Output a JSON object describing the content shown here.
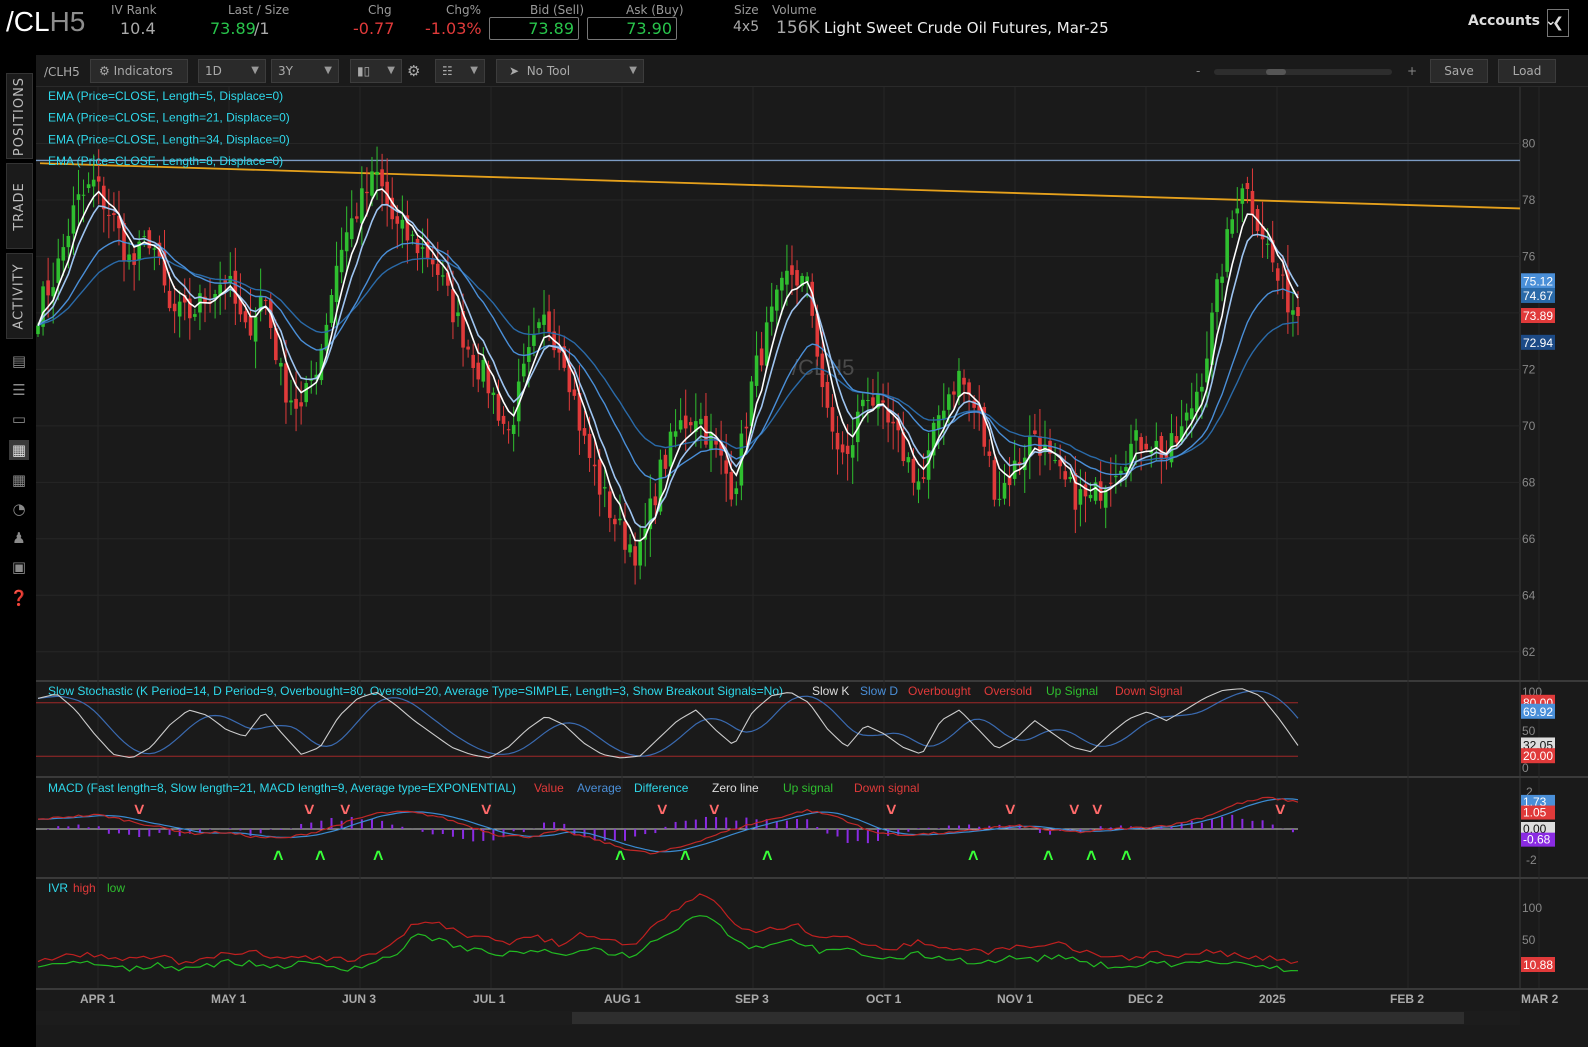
{
  "header": {
    "symbol_main": "/CL",
    "symbol_suffix": "H5",
    "iv_rank_label": "IV Rank",
    "iv_rank": "10.4",
    "last_size_label": "Last / Size",
    "last": "73.89",
    "size": "/1",
    "chg_label": "Chg",
    "chg": "-0.77",
    "chgpct_label": "Chg%",
    "chgpct": "-1.03%",
    "bid_label": "Bid (Sell)",
    "bid": "73.89",
    "ask_label": "Ask (Buy)",
    "ask": "73.90",
    "size_label": "Size",
    "size_val": "4x5",
    "volume_label": "Volume",
    "volume": "156K",
    "description": "Light Sweet Crude Oil Futures, Mar-25",
    "accounts": "Accounts",
    "accounts_icon": "chevron-down-icon",
    "collapse_icon": "chevron-left-icon"
  },
  "sidebar": {
    "tabs": [
      "POSITIONS",
      "TRADE",
      "ACTIVITY"
    ],
    "icons": [
      "list-icon",
      "list-lines-icon",
      "tv-icon",
      "chart-icon",
      "grid-icon",
      "gauge-icon",
      "people-icon",
      "calendar-icon",
      "help-icon"
    ]
  },
  "toolbar": {
    "symbol": "/CLH5",
    "indicators": "Indicators",
    "aggregation": "1D",
    "timeframe": "3Y",
    "tool": "No Tool",
    "zoom_minus": "-",
    "zoom_plus": "+",
    "save": "Save",
    "load": "Load"
  },
  "colors": {
    "up": "#2fbf2f",
    "down": "#e03a3a",
    "ema5": "#ffffff",
    "ema8": "#9ec4f0",
    "ema21": "#4a8fd8",
    "ema34": "#2a6aa8",
    "trendline": "#e6a11c",
    "resistance": "#7c9cc4",
    "panel_bg": "#1a1a1a",
    "label_cyan": "#2fd8ea"
  },
  "chart_data": [
    {
      "type": "candlestick",
      "title": "/CLH5",
      "legend": [
        "EMA (Price=CLOSE, Length=5, Displace=0)",
        "EMA (Price=CLOSE, Length=21, Displace=0)",
        "EMA (Price=CLOSE, Length=34, Displace=0)",
        "EMA (Price=CLOSE, Length=8, Displace=0)"
      ],
      "x_labels": [
        "APR 1",
        "MAY 1",
        "JUN 3",
        "JUL 1",
        "AUG 1",
        "SEP 3",
        "OCT 1",
        "NOV 1",
        "DEC 2",
        "2025",
        "FEB 2",
        "MAR 2"
      ],
      "y_ticks": [
        62,
        64,
        66,
        68,
        70,
        72,
        74,
        76,
        78,
        80
      ],
      "ylim": [
        61,
        82
      ],
      "close_anchors": [
        74.1,
        75.5,
        77.8,
        78.6,
        77.3,
        75.6,
        76.8,
        74.0,
        73.9,
        74.6,
        75.3,
        73.2,
        74.8,
        71.5,
        70.5,
        72.6,
        76.2,
        77.7,
        78.9,
        77.0,
        76.5,
        75.9,
        74.2,
        72.6,
        71.4,
        69.7,
        72.2,
        73.8,
        72.5,
        69.5,
        67.6,
        66.2,
        65.4,
        68.2,
        69.9,
        70.5,
        69.2,
        67.7,
        71.6,
        73.8,
        75.5,
        74.8,
        70.1,
        68.6,
        71.4,
        70.2,
        69.1,
        67.8,
        70.7,
        71.8,
        70.3,
        67.5,
        68.6,
        69.8,
        68.4,
        67.6,
        67.3,
        68.4,
        69.2,
        69.6,
        68.9,
        70.0,
        72.1,
        75.8,
        78.8,
        77.1,
        75.0,
        73.89
      ],
      "price_labels": [
        {
          "text": "75.12",
          "price": 75.12,
          "color": "#4a8fd8"
        },
        {
          "text": "74.67",
          "price": 74.6,
          "color": "#2a6aa8"
        },
        {
          "text": "73.89",
          "price": 73.89,
          "color": "#e03a3a"
        },
        {
          "text": "72.94",
          "price": 72.94,
          "color": "#1c4a86"
        }
      ],
      "resistance_price": 79.4,
      "trendline": {
        "from_price": 79.3,
        "to_price": 77.7
      },
      "watermark": "/CLH5"
    },
    {
      "type": "line",
      "title": "Slow Stochastic (K Period=14, D Period=9, Overbought=80, Oversold=20, Average Type=SIMPLE, Length=3, Show Breakout Signals=No)",
      "legend": [
        "Slow K",
        "Slow D",
        "Overbought",
        "Oversold",
        "Up Signal",
        "Down Signal"
      ],
      "y_ticks": [
        "100",
        "50",
        "0"
      ],
      "levels": [
        80,
        20
      ],
      "k_values": [
        85,
        90,
        72,
        45,
        22,
        18,
        30,
        55,
        72,
        66,
        50,
        42,
        70,
        45,
        22,
        30,
        65,
        85,
        92,
        78,
        60,
        45,
        30,
        22,
        18,
        30,
        50,
        65,
        55,
        35,
        22,
        18,
        20,
        40,
        60,
        72,
        50,
        32,
        70,
        88,
        92,
        80,
        50,
        30,
        55,
        45,
        30,
        22,
        60,
        72,
        50,
        28,
        40,
        60,
        45,
        30,
        25,
        45,
        62,
        70,
        60,
        72,
        85,
        94,
        96,
        88,
        62,
        32.05
      ],
      "labels": [
        {
          "text": "80.00",
          "value": 80,
          "color": "#e03a3a"
        },
        {
          "text": "69.92",
          "value": 69.92,
          "color": "#4a8fd8"
        },
        {
          "text": "32.05",
          "value": 32.05,
          "color": "#cccccc"
        },
        {
          "text": "20.00",
          "value": 20,
          "color": "#e03a3a"
        }
      ]
    },
    {
      "type": "bar",
      "title": "MACD (Fast length=8, Slow length=21, MACD length=9, Average type=EXPONENTIAL)",
      "legend": [
        "Value",
        "Average",
        "Difference",
        "Zero line",
        "Up signal",
        "Down signal"
      ],
      "y_ticks": [
        "2",
        "0",
        "-2"
      ],
      "ylim": [
        -3,
        3
      ],
      "value_anchors": [
        0.6,
        0.8,
        0.9,
        0.5,
        0.1,
        -0.3,
        -0.2,
        -0.5,
        -0.6,
        -0.2,
        0.4,
        1.0,
        1.1,
        0.8,
        0.2,
        -0.4,
        -0.5,
        -0.1,
        -0.6,
        -1.2,
        -1.6,
        -1.1,
        -0.4,
        0.2,
        0.7,
        1.2,
        0.8,
        -0.1,
        -0.4,
        -0.3,
        -0.2,
        0.1,
        0.2,
        -0.1,
        -0.2,
        0.0,
        0.1,
        0.3,
        0.8,
        1.6,
        2.0,
        1.73
      ],
      "down_signals_x": [
        139,
        309,
        345,
        486,
        662,
        714,
        891,
        1010,
        1074,
        1097,
        1280
      ],
      "up_signals_x": [
        279,
        321,
        379,
        621,
        686,
        768,
        974,
        1049,
        1092,
        1127
      ],
      "labels": [
        {
          "text": "1.73",
          "value": 1.73,
          "color": "#4a8fd8"
        },
        {
          "text": "1.05",
          "value": 1.05,
          "color": "#e03a3a"
        },
        {
          "text": "0.00",
          "value": 0,
          "color": "#cccccc"
        },
        {
          "text": "-0.68",
          "value": -0.68,
          "color": "#8a2be2"
        }
      ]
    },
    {
      "type": "line",
      "title": "IVR",
      "legend": [
        "high",
        "low"
      ],
      "y_ticks": [
        "100",
        "50"
      ],
      "high_anchors": [
        25,
        30,
        32,
        28,
        24,
        30,
        22,
        28,
        32,
        35,
        26,
        30,
        28,
        24,
        30,
        50,
        75,
        70,
        55,
        52,
        48,
        55,
        44,
        60,
        50,
        45,
        72,
        95,
        115,
        80,
        60,
        66,
        70,
        50,
        55,
        45,
        40,
        48,
        42,
        38,
        36,
        42,
        40,
        45,
        34,
        30,
        28,
        34,
        30,
        36,
        32,
        28,
        26,
        20
      ],
      "low_anchors": [
        15,
        18,
        22,
        16,
        12,
        20,
        14,
        18,
        22,
        20,
        16,
        20,
        18,
        14,
        20,
        32,
        58,
        50,
        38,
        35,
        32,
        38,
        28,
        42,
        35,
        30,
        52,
        70,
        88,
        60,
        40,
        48,
        50,
        34,
        38,
        30,
        26,
        32,
        28,
        24,
        22,
        28,
        26,
        30,
        20,
        18,
        16,
        22,
        18,
        24,
        20,
        18,
        14,
        10
      ],
      "label": {
        "text": "10.88",
        "color": "#e03a3a"
      }
    }
  ]
}
